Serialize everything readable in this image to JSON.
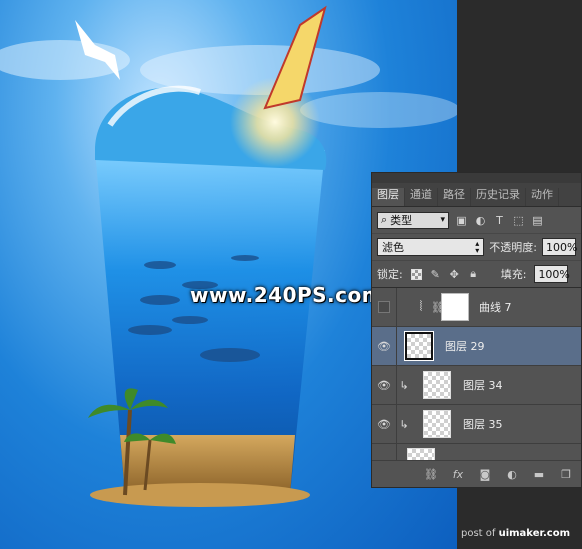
{
  "watermark": "www.240PS.com",
  "credit": {
    "prefix": "post of ",
    "site": "uimaker.com"
  },
  "panel": {
    "tabs": [
      "图层",
      "通道",
      "路径",
      "历史记录",
      "动作"
    ],
    "filter_label": "类型",
    "blend_mode": "滤色",
    "opacity_label": "不透明度:",
    "opacity_value": "100%",
    "lock_label": "锁定:",
    "fill_label": "填充:",
    "fill_value": "100%",
    "layers": [
      {
        "name": "曲线 7",
        "type": "adjustment-curves",
        "visible": false
      },
      {
        "name": "图层 29",
        "type": "pixel",
        "visible": true,
        "selected": true
      },
      {
        "name": "图层 34",
        "type": "pixel",
        "visible": true,
        "clipped": true
      },
      {
        "name": "图层 35",
        "type": "pixel",
        "visible": true,
        "clipped": true
      }
    ],
    "footer_icons": [
      "link-icon",
      "fx-icon",
      "mask-icon",
      "adjustment-icon",
      "folder-icon",
      "new-layer-icon"
    ]
  },
  "colors": {
    "selection": "#5a6e8a",
    "panel_bg": "#535353"
  }
}
